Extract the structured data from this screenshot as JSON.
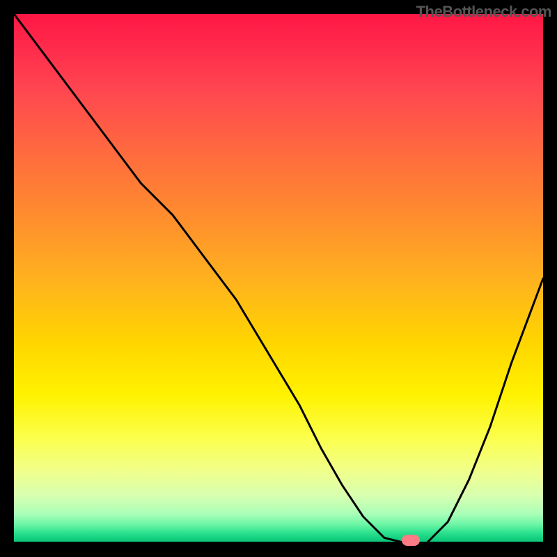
{
  "watermark": "TheBottleneck.com",
  "colors": {
    "background": "#000000",
    "curve": "#000000",
    "marker": "#ff7b85",
    "gradient_stops": [
      "#ff1744",
      "#ff2a4b",
      "#ff4550",
      "#ff6a3f",
      "#ff8c2e",
      "#ffb11f",
      "#ffd500",
      "#fff200",
      "#fbff4a",
      "#f2ff88",
      "#d8ffb0",
      "#aaffb8",
      "#6bf5a5",
      "#2ee28f",
      "#15d181",
      "#0cc277"
    ]
  },
  "chart_data": {
    "type": "line",
    "title": "",
    "xlabel": "",
    "ylabel": "",
    "xlim": [
      0,
      100
    ],
    "ylim": [
      0,
      100
    ],
    "grid": false,
    "series": [
      {
        "name": "bottleneck-curve",
        "x": [
          0,
          6,
          12,
          18,
          24,
          30,
          36,
          42,
          48,
          54,
          58,
          62,
          66,
          70,
          74,
          78,
          82,
          86,
          90,
          94,
          100
        ],
        "y": [
          100,
          92,
          84,
          76,
          68,
          62,
          54,
          46,
          36,
          26,
          18,
          11,
          5,
          1,
          0,
          0,
          4,
          12,
          22,
          34,
          50
        ]
      }
    ],
    "annotations": [
      {
        "name": "optimal-marker",
        "x": 75,
        "y": 0
      }
    ]
  }
}
